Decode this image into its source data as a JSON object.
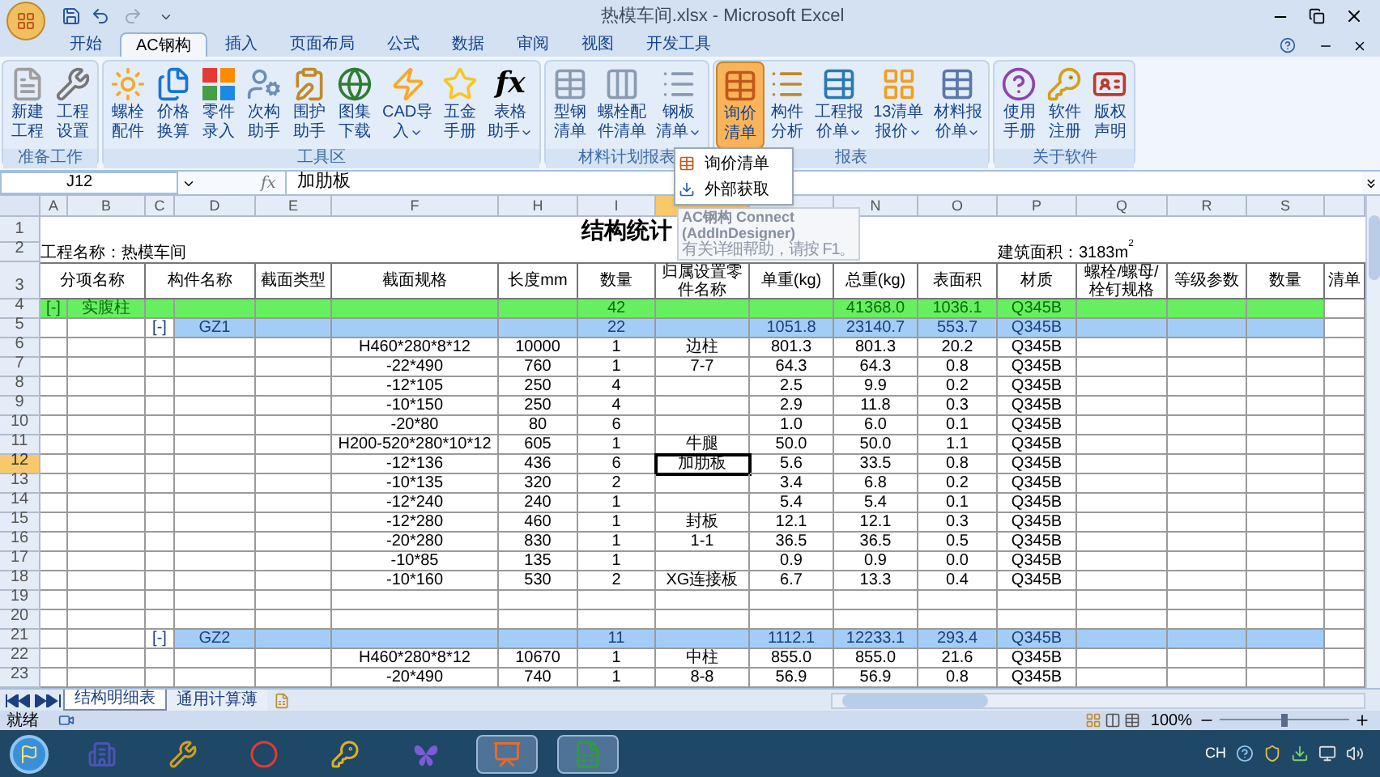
{
  "window": {
    "title": "热模车间.xlsx - Microsoft Excel"
  },
  "tabs": [
    {
      "label": "开始",
      "selected": false
    },
    {
      "label": "AC钢构",
      "selected": true
    },
    {
      "label": "插入",
      "selected": false
    },
    {
      "label": "页面布局",
      "selected": false
    },
    {
      "label": "公式",
      "selected": false
    },
    {
      "label": "数据",
      "selected": false
    },
    {
      "label": "审阅",
      "selected": false
    },
    {
      "label": "视图",
      "selected": false
    },
    {
      "label": "开发工具",
      "selected": false
    }
  ],
  "ribbon_groups": [
    {
      "label": "准备工作",
      "buttons": [
        {
          "label": [
            "新建",
            "工程"
          ],
          "dropdown": false,
          "pressed": false
        },
        {
          "label": [
            "工程",
            "设置"
          ],
          "dropdown": false,
          "pressed": false
        }
      ]
    },
    {
      "label": "工具区",
      "buttons": [
        {
          "label": [
            "螺栓",
            "配件"
          ],
          "dropdown": false,
          "pressed": false
        },
        {
          "label": [
            "价格",
            "换算"
          ],
          "dropdown": false,
          "pressed": false
        },
        {
          "label": [
            "零件",
            "录入"
          ],
          "dropdown": false,
          "pressed": false
        },
        {
          "label": [
            "次构",
            "助手"
          ],
          "dropdown": false,
          "pressed": false
        },
        {
          "label": [
            "围护",
            "助手"
          ],
          "dropdown": false,
          "pressed": false
        },
        {
          "label": [
            "图集",
            "下载"
          ],
          "dropdown": false,
          "pressed": false
        },
        {
          "label": [
            "CAD导",
            "入"
          ],
          "dropdown": true,
          "pressed": false
        },
        {
          "label": [
            "五金",
            "手册"
          ],
          "dropdown": false,
          "pressed": false
        },
        {
          "label": [
            "表格",
            "助手"
          ],
          "dropdown": true,
          "pressed": false,
          "glyph": "fx"
        }
      ]
    },
    {
      "label": "材料计划报表",
      "buttons": [
        {
          "label": [
            "型钢",
            "清单"
          ],
          "dropdown": false,
          "pressed": false
        },
        {
          "label": [
            "螺栓配",
            "件清单"
          ],
          "dropdown": false,
          "pressed": false
        },
        {
          "label": [
            "钢板",
            "清单"
          ],
          "dropdown": true,
          "pressed": false
        }
      ]
    },
    {
      "label": "报表",
      "buttons": [
        {
          "label": [
            "询价",
            "清单"
          ],
          "dropdown": false,
          "pressed": true
        },
        {
          "label": [
            "构件",
            "分析"
          ],
          "dropdown": false,
          "pressed": false
        },
        {
          "label": [
            "工程报",
            "价单"
          ],
          "dropdown": true,
          "pressed": false
        },
        {
          "label": [
            "13清单",
            "报价"
          ],
          "dropdown": true,
          "pressed": false
        },
        {
          "label": [
            "材料报",
            "价单"
          ],
          "dropdown": true,
          "pressed": false
        }
      ]
    },
    {
      "label": "关于软件",
      "buttons": [
        {
          "label": [
            "使用",
            "手册"
          ],
          "dropdown": false,
          "pressed": false
        },
        {
          "label": [
            "软件",
            "注册"
          ],
          "dropdown": false,
          "pressed": false
        },
        {
          "label": [
            "版权",
            "声明"
          ],
          "dropdown": false,
          "pressed": false
        }
      ]
    }
  ],
  "dropdown_menu": {
    "items": [
      "询价清单",
      "外部获取"
    ]
  },
  "tooltip": {
    "title": "AC钢构  Connect",
    "subtitle": "(AddInDesigner)",
    "hint": "有关详细帮助，请按 F1。"
  },
  "formula_bar": {
    "name_box": "J12",
    "fx": "fx",
    "value": "加肋板"
  },
  "columns": [
    {
      "header": "A",
      "selected": false
    },
    {
      "header": "B",
      "selected": false
    },
    {
      "header": "C",
      "selected": false
    },
    {
      "header": "D",
      "selected": false
    },
    {
      "header": "E",
      "selected": false
    },
    {
      "header": "F",
      "selected": false
    },
    {
      "header": "H",
      "selected": false
    },
    {
      "header": "I",
      "selected": false
    },
    {
      "selected": true
    },
    {
      "selected": false
    },
    {
      "header": "N",
      "selected": false
    },
    {
      "header": "O",
      "selected": false
    },
    {
      "header": "P",
      "selected": false
    },
    {
      "header": "Q",
      "selected": false
    },
    {
      "header": "R",
      "selected": false
    },
    {
      "header": "S",
      "selected": false
    },
    {
      "selected": false
    }
  ],
  "rows": [
    {
      "num": "1",
      "kind": "title",
      "selected": false,
      "text": "结构统计"
    },
    {
      "num": "2",
      "kind": "info",
      "selected": false,
      "project": "工程名称：热模车间",
      "area": "建筑面积：3183m$^{2}$"
    },
    {
      "num": "3",
      "kind": "header",
      "selected": false,
      "headers": [
        "分项名称",
        "构件名称",
        "截面类型",
        "截面规格",
        "长度mm",
        "数量",
        "归属设置零件名称",
        "单重(kg)",
        "总重(kg)",
        "表面积",
        "材质",
        "螺栓/螺母/栓钉规格",
        "等级参数",
        "数量",
        "清单"
      ]
    },
    {
      "num": "4",
      "kind": "group",
      "selected": false,
      "cells": {
        "A": "[-]",
        "B": "实腹柱",
        "I": "42",
        "N": "41368.0",
        "O": "1036.1",
        "P": "Q345B"
      }
    },
    {
      "num": "5",
      "kind": "subgroup",
      "selected": false,
      "cells": {
        "C": "[-]",
        "D": "GZ1",
        "I": "22",
        "M": "1051.8",
        "N": "23140.7",
        "O": "553.7",
        "P": "Q345B"
      }
    },
    {
      "num": "6",
      "kind": "item",
      "selected": false,
      "cells": {
        "F": "H460*280*8*12",
        "H": "10000",
        "I": "1",
        "J": "边柱",
        "M": "801.3",
        "N": "801.3",
        "O": "20.2",
        "P": "Q345B"
      }
    },
    {
      "num": "7",
      "kind": "item",
      "selected": false,
      "cells": {
        "F": "-22*490",
        "H": "760",
        "I": "1",
        "J": "7-7",
        "M": "64.3",
        "N": "64.3",
        "O": "0.8",
        "P": "Q345B"
      }
    },
    {
      "num": "8",
      "kind": "item",
      "selected": false,
      "cells": {
        "F": "-12*105",
        "H": "250",
        "I": "4",
        "M": "2.5",
        "N": "9.9",
        "O": "0.2",
        "P": "Q345B"
      }
    },
    {
      "num": "9",
      "kind": "item",
      "selected": false,
      "cells": {
        "F": "-10*150",
        "H": "250",
        "I": "4",
        "M": "2.9",
        "N": "11.8",
        "O": "0.3",
        "P": "Q345B"
      }
    },
    {
      "num": "10",
      "kind": "item",
      "selected": false,
      "cells": {
        "F": "-20*80",
        "H": "80",
        "I": "6",
        "M": "1.0",
        "N": "6.0",
        "O": "0.1",
        "P": "Q345B"
      }
    },
    {
      "num": "11",
      "kind": "item",
      "selected": false,
      "cells": {
        "F": "H200-520*280*10*12",
        "H": "605",
        "I": "1",
        "J": "牛腿",
        "M": "50.0",
        "N": "50.0",
        "O": "1.1",
        "P": "Q345B"
      }
    },
    {
      "num": "12",
      "kind": "item",
      "selected": true,
      "cells": {
        "F": "-12*136",
        "H": "436",
        "I": "6",
        "J": "加肋板",
        "M": "5.6",
        "N": "33.5",
        "O": "0.8",
        "P": "Q345B"
      }
    },
    {
      "num": "13",
      "kind": "item",
      "selected": false,
      "cells": {
        "F": "-10*135",
        "H": "320",
        "I": "2",
        "M": "3.4",
        "N": "6.8",
        "O": "0.2",
        "P": "Q345B"
      }
    },
    {
      "num": "14",
      "kind": "item",
      "selected": false,
      "cells": {
        "F": "-12*240",
        "H": "240",
        "I": "1",
        "M": "5.4",
        "N": "5.4",
        "O": "0.1",
        "P": "Q345B"
      }
    },
    {
      "num": "15",
      "kind": "item",
      "selected": false,
      "cells": {
        "F": "-12*280",
        "H": "460",
        "I": "1",
        "J": "封板",
        "M": "12.1",
        "N": "12.1",
        "O": "0.3",
        "P": "Q345B"
      }
    },
    {
      "num": "16",
      "kind": "item",
      "selected": false,
      "cells": {
        "F": "-20*280",
        "H": "830",
        "I": "1",
        "J": "1-1",
        "M": "36.5",
        "N": "36.5",
        "O": "0.5",
        "P": "Q345B"
      }
    },
    {
      "num": "17",
      "kind": "item",
      "selected": false,
      "cells": {
        "F": "-10*85",
        "H": "135",
        "I": "1",
        "M": "0.9",
        "N": "0.9",
        "O": "0.0",
        "P": "Q345B"
      }
    },
    {
      "num": "18",
      "kind": "item",
      "selected": false,
      "cells": {
        "F": "-10*160",
        "H": "530",
        "I": "2",
        "J": "XG连接板",
        "M": "6.7",
        "N": "13.3",
        "O": "0.4",
        "P": "Q345B"
      }
    },
    {
      "num": "19",
      "kind": "item",
      "selected": false,
      "cells": {}
    },
    {
      "num": "20",
      "kind": "item",
      "selected": false,
      "cells": {}
    },
    {
      "num": "21",
      "kind": "subgroup",
      "selected": false,
      "cells": {
        "C": "[-]",
        "D": "GZ2",
        "I": "11",
        "M": "1112.1",
        "N": "12233.1",
        "O": "293.4",
        "P": "Q345B"
      }
    },
    {
      "num": "22",
      "kind": "item",
      "selected": false,
      "cells": {
        "F": "H460*280*8*12",
        "H": "10670",
        "I": "1",
        "J": "中柱",
        "M": "855.0",
        "N": "855.0",
        "O": "21.6",
        "P": "Q345B"
      }
    },
    {
      "num": "23",
      "kind": "item",
      "selected": false,
      "cells": {
        "F": "-20*490",
        "H": "740",
        "I": "1",
        "J": "8-8",
        "M": "56.9",
        "N": "56.9",
        "O": "0.8",
        "P": "Q345B"
      }
    }
  ],
  "sheet_tabs": [
    {
      "label": "结构明细表",
      "selected": true
    },
    {
      "label": "通用计算薄",
      "selected": false
    }
  ],
  "status_bar": {
    "status": "就绪",
    "zoom": "100%",
    "zoom_slider": {
      "level": 0.5
    }
  },
  "taskbar": {
    "apps": [
      {
        "active": false
      },
      {
        "active": false
      },
      {
        "active": false
      },
      {
        "active": false
      },
      {
        "active": false
      },
      {
        "active": true
      },
      {
        "active": true
      }
    ],
    "tray_language": "CH"
  }
}
